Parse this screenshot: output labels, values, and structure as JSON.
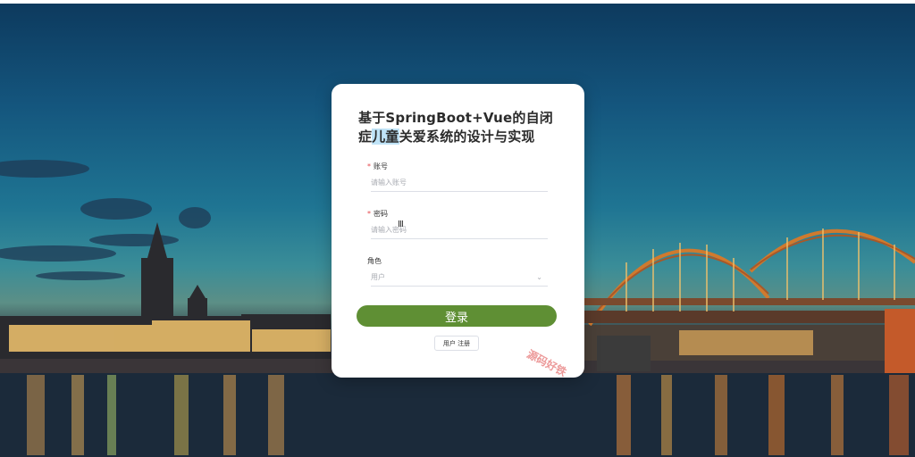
{
  "login": {
    "title_highlight": "儿童",
    "title_before": "基于SpringBoot+Vue的自闭症",
    "title_after": "关爱系统的设计与实现",
    "account_label": "账号",
    "account_placeholder": "请输入账号",
    "password_label": "密码",
    "password_placeholder": "请输入密码",
    "role_label": "角色",
    "role_value": "用户",
    "login_button": "登录",
    "register_button": "用户 注册"
  },
  "watermark": {
    "text": "源码好铁"
  },
  "colors": {
    "primary_green": "#5f8f34",
    "required_star": "#e5484d",
    "highlight": "#bfe3f7"
  },
  "icons": {
    "select_arrow": "chevron-down-icon",
    "text_cursor": "text-cursor-icon"
  }
}
